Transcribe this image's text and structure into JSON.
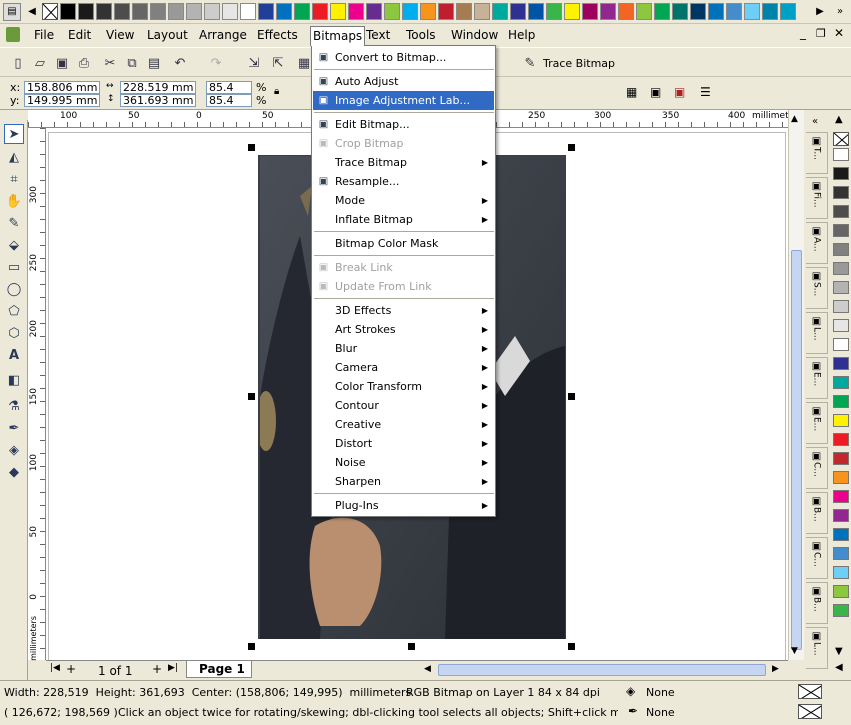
{
  "menubar": {
    "items": [
      "File",
      "Edit",
      "View",
      "Layout",
      "Arrange",
      "Effects",
      "Bitmaps",
      "Text",
      "Tools",
      "Window",
      "Help"
    ]
  },
  "palette_top": [
    "#000000",
    "#1a1a1a",
    "#333333",
    "#4d4d4d",
    "#666666",
    "#808080",
    "#999999",
    "#b3b3b3",
    "#cccccc",
    "#e6e6e6",
    "#ffffff",
    "#1f3f99",
    "#0070c0",
    "#00a651",
    "#ed1c24",
    "#ffef00",
    "#ec008c",
    "#662d91",
    "#8dc63f",
    "#00aeef",
    "#f7941d",
    "#be1e2d",
    "#a67c52",
    "#c7b299",
    "#00a99d",
    "#2e3192",
    "#0054a6",
    "#39b54a",
    "#fff200",
    "#9e005d",
    "#92278f",
    "#f26522",
    "#8dc63f",
    "#00a651",
    "#00746b",
    "#003663",
    "#0072bc",
    "#448ccb",
    "#6dcff6",
    "#0083a9",
    "#00a0c6",
    "#005b7f"
  ],
  "toolbar": {
    "trace_bitmap": "Trace Bitmap"
  },
  "props": {
    "x_label": "x:",
    "y_label": "y:",
    "x": "158.806 mm",
    "y": "149.995 mm",
    "w": "228.519 mm",
    "h": "361.693 mm",
    "sx": "85.4",
    "sy": "85.4",
    "pct": "%"
  },
  "ruler": {
    "top_ticks": [
      "100",
      "50",
      "0",
      "50",
      "250",
      "300",
      "350",
      "400"
    ],
    "unit": "millimeters",
    "left_ticks": [
      "300",
      "250",
      "200",
      "150",
      "100",
      "50",
      "0"
    ],
    "left_unit": "millimeters"
  },
  "menu": {
    "items": [
      {
        "label": "Convert to Bitmap...",
        "icon": "convert-bitmap-icon"
      },
      {
        "sep": true
      },
      {
        "label": "Auto Adjust",
        "icon": "auto-adjust-icon"
      },
      {
        "label": "Image Adjustment Lab...",
        "icon": "image-lab-icon",
        "highlighted": true
      },
      {
        "sep": true
      },
      {
        "label": "Edit Bitmap...",
        "icon": "edit-bitmap-icon"
      },
      {
        "label": "Crop Bitmap",
        "icon": "crop-icon",
        "disabled": true
      },
      {
        "label": "Trace Bitmap",
        "submenu": true
      },
      {
        "label": "Resample...",
        "icon": "resample-icon"
      },
      {
        "label": "Mode",
        "submenu": true
      },
      {
        "label": "Inflate Bitmap",
        "submenu": true
      },
      {
        "sep": true
      },
      {
        "label": "Bitmap Color Mask"
      },
      {
        "sep": true
      },
      {
        "label": "Break Link",
        "icon": "break-link-icon",
        "disabled": true
      },
      {
        "label": "Update From Link",
        "icon": "update-link-icon",
        "disabled": true
      },
      {
        "sep": true
      },
      {
        "label": "3D Effects",
        "submenu": true
      },
      {
        "label": "Art Strokes",
        "submenu": true
      },
      {
        "label": "Blur",
        "submenu": true
      },
      {
        "label": "Camera",
        "submenu": true
      },
      {
        "label": "Color Transform",
        "submenu": true
      },
      {
        "label": "Contour",
        "submenu": true
      },
      {
        "label": "Creative",
        "submenu": true
      },
      {
        "label": "Distort",
        "submenu": true
      },
      {
        "label": "Noise",
        "submenu": true
      },
      {
        "label": "Sharpen",
        "submenu": true
      },
      {
        "sep": true
      },
      {
        "label": "Plug-Ins",
        "submenu": true
      }
    ]
  },
  "pagebar": {
    "page_count": "1 of 1",
    "page_tab": "Page 1"
  },
  "status": {
    "line1_left": "Width: 228,519  Height: 361,693  Center: (158,806; 149,995)  millimeters",
    "line1_mid": "RGB Bitmap on Layer 1 84 x 84 dpi",
    "fill": "None",
    "line2_left": "( 126,672; 198,569 )",
    "line2_msg": "Click an object twice for rotating/skewing; dbl-clicking tool selects all objects; Shift+click multi-selects; ...",
    "outline": "None"
  },
  "docker_tabs": [
    "T...",
    "Fi...",
    "A...",
    "S...",
    "L...",
    "E...",
    "E...",
    "C...",
    "B...",
    "C...",
    "B...",
    "L..."
  ],
  "palette_right": [
    "#ffffff",
    "#1a1a1a",
    "#333333",
    "#4d4d4d",
    "#666666",
    "#808080",
    "#999999",
    "#b3b3b3",
    "#cccccc",
    "#e6e6e6",
    "#ffffff",
    "#2e3192",
    "#00a99d",
    "#00a651",
    "#fff200",
    "#ed1c24",
    "#c1272d",
    "#f7941d",
    "#ec008c",
    "#92278f",
    "#0072bc",
    "#448ccb",
    "#6dcff6",
    "#8dc63f",
    "#39b54a"
  ]
}
